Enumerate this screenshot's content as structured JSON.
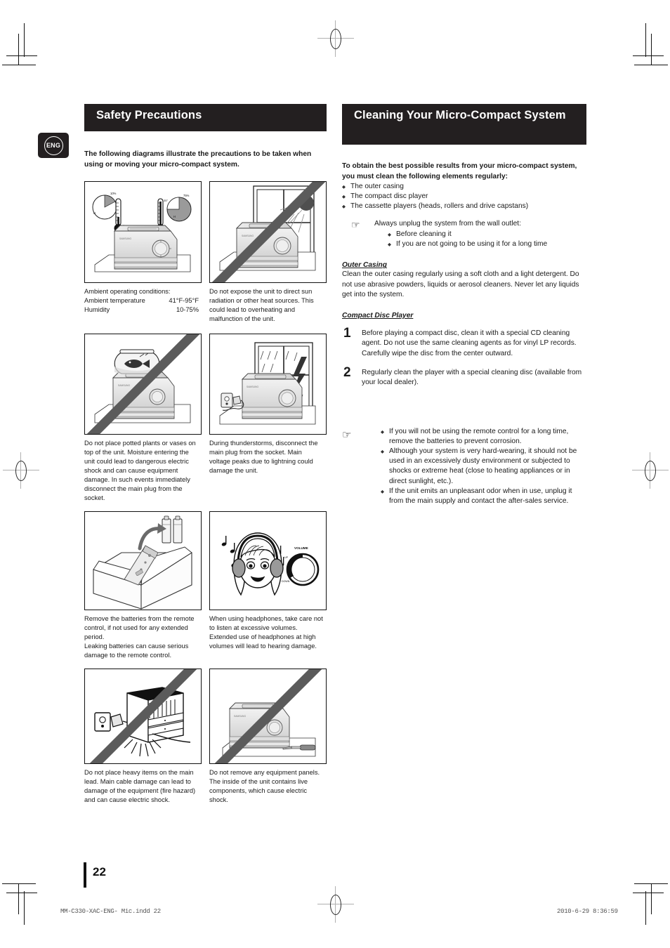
{
  "badge": {
    "label": "ENG",
    "icon": "eng-circle-badge"
  },
  "left": {
    "heading": "Safety Precautions",
    "intro": "The following diagrams illustrate the precautions to be taken when using or moving your micro-compact system.",
    "figures": [
      {
        "id": "ambient-conditions",
        "illustration": "stereo-with-thermometers-and-humidity-pies",
        "prohibited": false,
        "caption_title": "Ambient operating conditions:",
        "caption_rows": [
          {
            "label": "Ambient temperature",
            "value": "41°F-95°F"
          },
          {
            "label": "Humidity",
            "value": "10-75%"
          }
        ],
        "caption": ""
      },
      {
        "id": "no-direct-sun",
        "illustration": "stereo-near-sunlit-window",
        "prohibited": true,
        "caption": "Do not expose the unit to direct sun radiation or other heat sources. This could lead to overheating and malfunction of the unit."
      },
      {
        "id": "no-vases-on-unit",
        "illustration": "fishbowl-on-stereo",
        "prohibited": true,
        "caption": "Do not place potted plants or vases on top of the unit. Moisture entering the unit could lead to dangerous electric shock and can cause equipment damage. In such events immediately disconnect the main plug from the socket."
      },
      {
        "id": "thunderstorm-unplug",
        "illustration": "stereo-unplugged-during-lightning-storm",
        "prohibited": false,
        "caption": "During thunderstorms, disconnect the main plug from the socket. Main voltage peaks due to lightning could damage the unit."
      },
      {
        "id": "remove-batteries",
        "illustration": "remote-control-in-box-with-batteries-removed",
        "prohibited": false,
        "caption": "Remove the batteries from the remote control, if not used for any extended period.\nLeaking batteries can cause serious damage to the remote control."
      },
      {
        "id": "headphone-volume",
        "illustration": "girl-wearing-headphones-with-volume-knob",
        "prohibited": false,
        "knob_label": "VOLUME",
        "caption": "When using headphones, take care not to listen at excessive volumes. Extended use of headphones at high volumes will lead to hearing damage."
      },
      {
        "id": "no-heavy-items-on-lead",
        "illustration": "furniture-crushing-power-cable",
        "prohibited": true,
        "caption": "Do not place heavy items on the main lead. Main cable damage can lead to damage of the equipment (fire hazard) and can cause electric shock."
      },
      {
        "id": "do-not-remove-panels",
        "illustration": "stereo-with-screwdriver",
        "prohibited": true,
        "caption": "Do not remove any equipment panels. The inside of the unit contains live components, which cause electric shock."
      }
    ]
  },
  "right": {
    "heading": "Cleaning Your Micro-Compact System",
    "intro": "To obtain the best possible results from your micro-compact system, you must clean the following elements regularly:",
    "elements": [
      "The outer casing",
      "The compact disc player",
      "The cassette players (heads, rollers and drive capstans)"
    ],
    "unplug_note": {
      "icon": "pointing-hand-icon",
      "lead": "Always unplug the system from the wall outlet:",
      "items": [
        "Before cleaning it",
        "If you are not going to be using it for a long time"
      ]
    },
    "outer_casing": {
      "heading": "Outer Casing",
      "body": "Clean the outer casing regularly using a soft cloth and a light detergent. Do not use abrasive powders, liquids or aerosol cleaners. Never let any liquids get into the system."
    },
    "cd_player": {
      "heading": "Compact Disc Player",
      "steps": [
        {
          "num": "1",
          "text": "Before playing a compact disc, clean it with a special CD cleaning agent. Do not use the same cleaning agents as for vinyl LP records. Carefully wipe the disc from the center outward."
        },
        {
          "num": "2",
          "text": "Regularly clean the player with a special cleaning disc (available from your local dealer)."
        }
      ]
    },
    "final_note": {
      "icon": "pointing-hand-icon",
      "items": [
        "If you will not be using the remote control for a long time, remove the batteries to prevent corrosion.",
        "Although your system is very hard-wearing, it should not be used in an excessively dusty environment or subjected to shocks or extreme heat (close to heating appliances or in direct sunlight, etc.).",
        "If the unit emits an unpleasant odor when in use, unplug it from the main supply and contact the after-sales service."
      ]
    }
  },
  "footer": {
    "page_number": "22",
    "file_info": "MM-C330-XAC-ENG- Mic.indd   22",
    "timestamp": "2010-6-29   8:36:59"
  },
  "colors": {
    "band": "#231f20",
    "text": "#1a1a1a",
    "slash": "#5b5b5b"
  }
}
